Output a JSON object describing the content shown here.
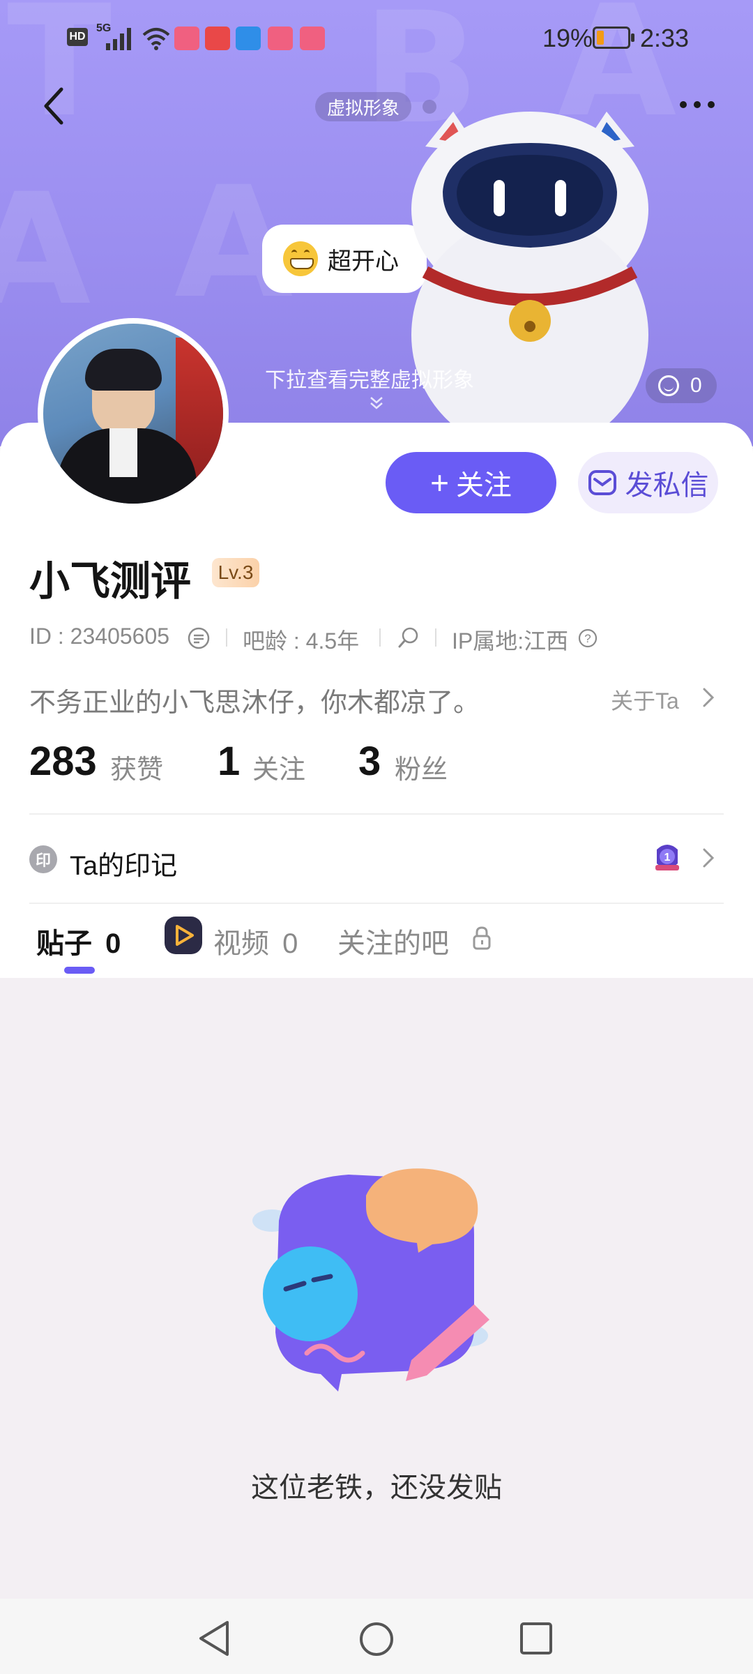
{
  "status_bar": {
    "network": "5G",
    "hd": "HD",
    "battery": "19%",
    "time": "2:33"
  },
  "header": {
    "virtual_tag": "虚拟形象",
    "speech_bubble": "超开心",
    "pull_hint": "下拉查看完整虚拟形象",
    "like_count": "0",
    "accent": "#6a5cf5"
  },
  "profile": {
    "name": "小飞测评",
    "level": "Lv.3",
    "id_text": "ID : 23405605",
    "bar_age": "吧龄 : 4.5年",
    "ip": "IP属地:江西",
    "bio": "不务正业的小飞思沐仔，你木都凉了。",
    "about": "关于Ta",
    "follow_label": "关注",
    "message_label": "发私信"
  },
  "stats": [
    {
      "value": "283",
      "label": "获赞"
    },
    {
      "value": "1",
      "label": "关注"
    },
    {
      "value": "3",
      "label": "粉丝"
    }
  ],
  "marks": {
    "badge": "印",
    "label": "Ta的印记"
  },
  "tabs": [
    {
      "label": "贴子",
      "count": "0"
    },
    {
      "label": "视频",
      "count": "0"
    },
    {
      "label": "关注的吧"
    }
  ],
  "empty_state": {
    "text": "这位老铁，还没发贴"
  },
  "nav": [
    "back",
    "home",
    "recents"
  ]
}
